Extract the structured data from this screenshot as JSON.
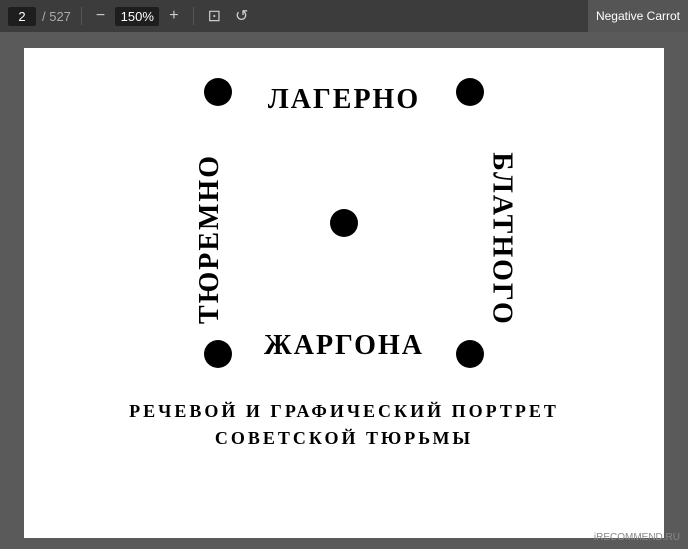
{
  "toolbar": {
    "page_current": "2",
    "page_total": "/ 527",
    "zoom": "150%",
    "zoom_out_label": "−",
    "zoom_in_label": "+",
    "fit_icon": "⊡",
    "rotate_icon": "↺"
  },
  "badge": {
    "label": "Negative Carrot"
  },
  "page": {
    "label_top": "ЛАГЕРНО",
    "label_left": "ТЮРЕМНО",
    "label_right": "БЛАТНОГО",
    "label_bottom": "ЖАРГОНА",
    "subtitle_line1": "РЕЧЕВОЙ  И  ГРАФИЧЕСКИЙ  ПОРТРЕТ",
    "subtitle_line2": "СОВЕТСКОЙ  ТЮРЬМЫ"
  },
  "watermark": {
    "label": "iRECOMMEND.RU"
  }
}
